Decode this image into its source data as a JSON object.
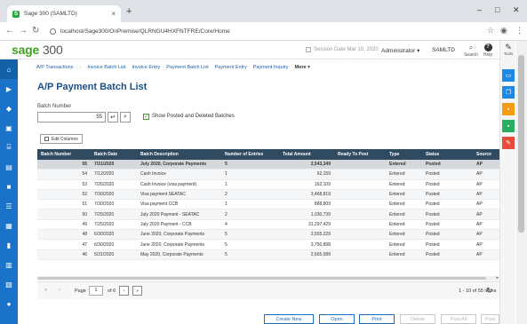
{
  "browser": {
    "tab_title": "Sage 300 (SAMLTD)",
    "tab_close": "×",
    "new_tab": "+",
    "url": "localhost/Sage300/OnPremise/QLRNGU4HXFNTFRE/Core/Home",
    "minimize": "–",
    "maximize": "□",
    "close": "✕"
  },
  "header": {
    "logo_word": "sage",
    "logo_num": "300",
    "session_date_label": "Session Date",
    "session_date_value": "Mar 10, 2020",
    "user": "Administrator ▾",
    "company": "SAMLTD",
    "search_label": "Search",
    "help_label": "Help",
    "tools_label": "Tools"
  },
  "subnav": {
    "items": [
      "A/P Transactions",
      "Invoice Batch List",
      "Invoice Entry",
      "Payment Batch List",
      "Payment Entry",
      "Payment Inquiry"
    ],
    "more": "More ▾"
  },
  "page": {
    "title": "A/P Payment Batch List",
    "batch_number_label": "Batch Number",
    "batch_number_value": "55",
    "show_posted_label": "Show Posted and Deleted Batches",
    "edit_columns_label": "Edit Columns"
  },
  "grid": {
    "columns": [
      "Batch Number",
      "Batch Date",
      "Batch Description",
      "Number of Entries",
      "Total Amount",
      "Ready To Post",
      "Type",
      "Status",
      "Source"
    ],
    "rows": [
      [
        "55",
        "7/31/2020",
        "July 2020, Corporate Payments",
        "5",
        "2,543,349",
        "",
        "Entered",
        "Posted",
        "AP"
      ],
      [
        "54",
        "7/12/2020",
        "Cash Invoice",
        "1",
        "62,159",
        "",
        "Entered",
        "Posted",
        "AP"
      ],
      [
        "53",
        "7/26/2020",
        "Cash Invoice (visa payment)",
        "1",
        "162,109",
        "",
        "Entered",
        "Posted",
        "AP"
      ],
      [
        "52",
        "7/30/2020",
        "Visa payment SEATAC",
        "2",
        "3,468,819",
        "",
        "Entered",
        "Posted",
        "AP"
      ],
      [
        "51",
        "7/30/2020",
        "Visa payment CCB",
        "1",
        "888,809",
        "",
        "Entered",
        "Posted",
        "AP"
      ],
      [
        "50",
        "7/25/2020",
        "July 2020 Payment - SEATAC",
        "2",
        "1,030,739",
        "",
        "Entered",
        "Posted",
        "AP"
      ],
      [
        "49",
        "7/25/2020",
        "July 2020 Payment - CCB",
        "4",
        "31,297,429",
        "",
        "Entered",
        "Posted",
        "AP"
      ],
      [
        "48",
        "6/30/2020",
        "June 2020, Corporate Payments",
        "5",
        "2,555,229",
        "",
        "Entered",
        "Posted",
        "AP"
      ],
      [
        "47",
        "6/30/2020",
        "June 2020, Corporate Payments",
        "5",
        "3,750,898",
        "",
        "Entered",
        "Posted",
        "AP"
      ],
      [
        "46",
        "5/31/2020",
        "May 2020, Corporate Payments",
        "5",
        "2,665,089",
        "",
        "Entered",
        "Posted",
        "AP"
      ]
    ],
    "selected_row": 0
  },
  "pager": {
    "page_label": "Page",
    "page_value": "1",
    "of_label": "of 6",
    "count_label": "1 - 10 of 55 items"
  },
  "actions": {
    "create_new": "Create New",
    "open": "Open",
    "print": "Print",
    "delete": "Delete",
    "post_all": "Post All",
    "post": "Post"
  },
  "colors": {
    "accent_blue": "#1a6fc4",
    "sidebar_blue": "#1a73c8",
    "sage_green": "#41a020",
    "grid_header": "#304a60",
    "rail_blue": "#1e88e5",
    "rail_orange": "#f39c12",
    "rail_green": "#27ae60",
    "rail_red": "#e74c3c"
  }
}
